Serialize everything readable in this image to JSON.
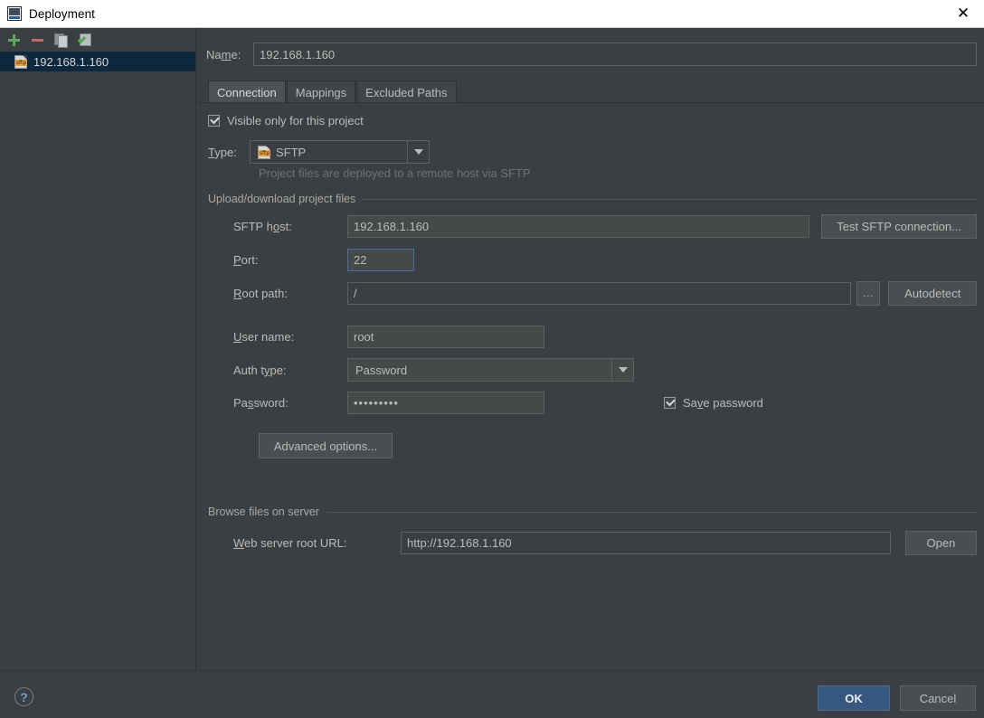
{
  "window": {
    "title": "Deployment",
    "icon": "intellij-idea-icon",
    "close_label": "✕"
  },
  "sidebar": {
    "toolbar": [
      {
        "name": "add-button",
        "icon": "plus-icon",
        "label": "+"
      },
      {
        "name": "remove-button",
        "icon": "minus-icon",
        "label": "−"
      },
      {
        "name": "copy-button",
        "icon": "copy-icon",
        "label": "Copy"
      },
      {
        "name": "set-default-button",
        "icon": "check-document-icon",
        "label": "Use as default"
      }
    ],
    "items": [
      {
        "label": "192.168.1.160",
        "icon": "sftp-server-icon",
        "icon_text": "sftp",
        "selected": true
      }
    ]
  },
  "name_row": {
    "label_pre": "Na",
    "label_mnemonic": "m",
    "label_post": "e:",
    "value": "192.168.1.160",
    "placeholder": ""
  },
  "tabs": [
    {
      "label": "Connection",
      "active": true
    },
    {
      "label": "Mappings",
      "active": false
    },
    {
      "label": "Excluded Paths",
      "active": false
    }
  ],
  "connection": {
    "visible_only_checkbox": {
      "label": "Visible only for this project",
      "checked": true
    },
    "type": {
      "label_pre": "",
      "label_mnemonic": "T",
      "label_post": "ype:",
      "value": "SFTP",
      "icon_text": "sftp",
      "hint": "Project files are deployed to a remote host via SFTP"
    },
    "upload_group": {
      "title": "Upload/download project files",
      "sftp_host": {
        "label_pre": "SFTP h",
        "label_mnemonic": "o",
        "label_post": "st:",
        "value": "192.168.1.160"
      },
      "test_button": "Test SFTP connection...",
      "port": {
        "label_pre": "",
        "label_mnemonic": "P",
        "label_post": "ort:",
        "value": "22",
        "focused": true
      },
      "root_path": {
        "label_pre": "",
        "label_mnemonic": "R",
        "label_post": "oot path:",
        "value": "/"
      },
      "browse_button": "...",
      "autodetect_button": "Autodetect",
      "user_name": {
        "label_pre": "",
        "label_mnemonic": "U",
        "label_post": "ser name:",
        "value": "root"
      },
      "auth_type": {
        "label_pre": "Auth t",
        "label_mnemonic": "y",
        "label_post": "pe:",
        "value": "Password"
      },
      "password": {
        "label_pre": "Pa",
        "label_mnemonic": "s",
        "label_post": "sword:",
        "value": "•••••••••"
      },
      "save_password": {
        "label_pre": "Sa",
        "label_mnemonic": "v",
        "label_post": "e password",
        "checked": true
      },
      "advanced_button": "Advanced options..."
    },
    "browse_group": {
      "title": "Browse files on server",
      "web_url": {
        "label_pre": "",
        "label_mnemonic": "W",
        "label_post": "eb server root URL:",
        "value": "http://192.168.1.160"
      },
      "open_button": "Open"
    }
  },
  "footer": {
    "help_label": "?",
    "ok_label": "OK",
    "cancel_label": "Cancel"
  },
  "colors": {
    "background": "#3c3f41",
    "selection": "#0d293e",
    "accent_ok": "#365880",
    "focus_border": "#4b6eaf",
    "text": "#bbbbbb",
    "hint_text": "#6e7174"
  }
}
